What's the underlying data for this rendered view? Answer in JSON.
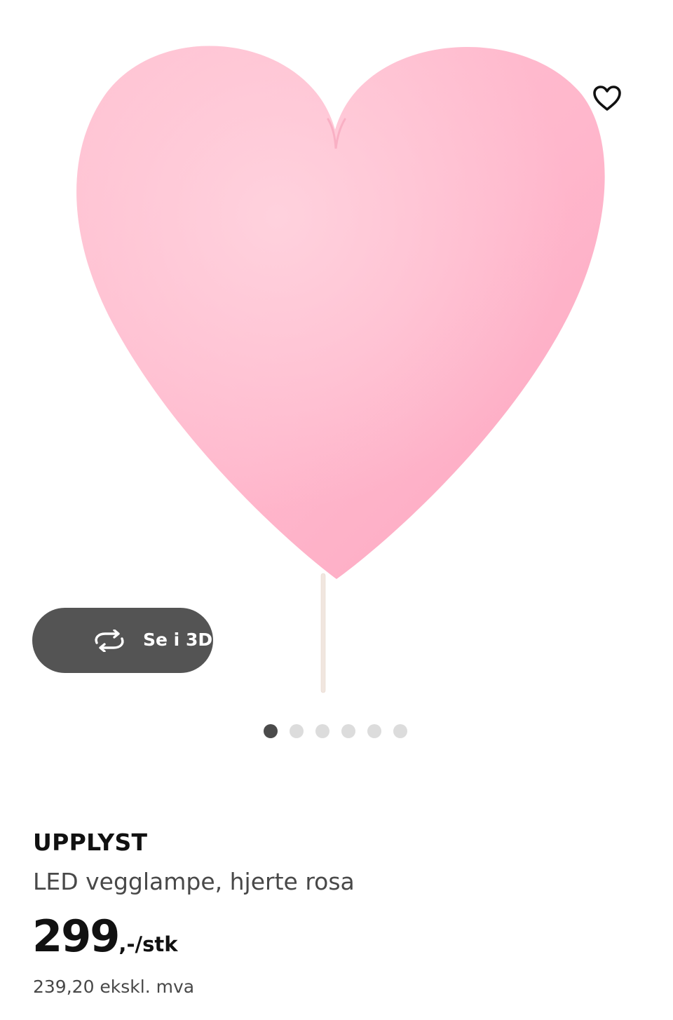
{
  "gallery": {
    "image_alt": "UPPLYST LED vegglampe, hjerte rosa",
    "favourite_icon": "heart-outline-icon",
    "view_3d": {
      "icon": "rotate-3d-icon",
      "label": "Se i 3D"
    },
    "pagination": {
      "total": 6,
      "active_index": 0
    },
    "colors": {
      "heart_pink": "#ffb5cc",
      "button_bg": "#545454",
      "dot_active": "#4b4b4b",
      "dot_inactive": "#dcdcdc"
    }
  },
  "product": {
    "name": "UPPLYST",
    "description": "LED vegglampe, hjerte rosa",
    "price": {
      "integer": "299",
      "suffix": ",-/stk",
      "excl_vat": "239,20 ekskl. mva"
    }
  }
}
